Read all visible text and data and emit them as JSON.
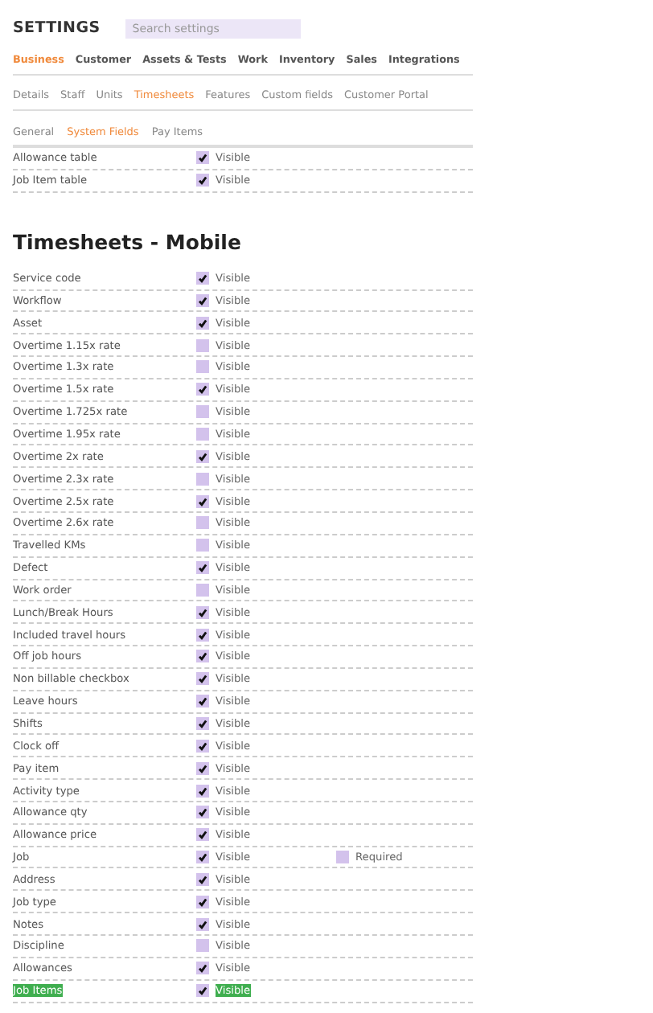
{
  "header": {
    "title": "SETTINGS",
    "search": {
      "placeholder": "Search settings"
    }
  },
  "main_tabs": [
    {
      "label": "Business",
      "selected": true
    },
    {
      "label": "Customer",
      "selected": false
    },
    {
      "label": "Assets & Tests",
      "selected": false
    },
    {
      "label": "Work",
      "selected": false
    },
    {
      "label": "Inventory",
      "selected": false
    },
    {
      "label": "Sales",
      "selected": false
    },
    {
      "label": "Integrations",
      "selected": false
    }
  ],
  "sub_tabs": [
    {
      "label": "Details",
      "selected": false
    },
    {
      "label": "Staff",
      "selected": false
    },
    {
      "label": "Units",
      "selected": false
    },
    {
      "label": "Timesheets",
      "selected": true
    },
    {
      "label": "Features",
      "selected": false
    },
    {
      "label": "Custom fields",
      "selected": false
    },
    {
      "label": "Customer Portal",
      "selected": false
    }
  ],
  "section_tabs": [
    {
      "label": "General",
      "selected": false
    },
    {
      "label": "System Fields",
      "selected": true
    },
    {
      "label": "Pay Items",
      "selected": false
    }
  ],
  "top_fields": [
    {
      "name": "Allowance table",
      "visible_label": "Visible",
      "visible": true,
      "highlighted": false
    },
    {
      "name": "Job Item table",
      "visible_label": "Visible",
      "visible": true,
      "highlighted": false
    }
  ],
  "mobile_section": {
    "heading": "Timesheets - Mobile",
    "fields": [
      {
        "name": "Service code",
        "visible_label": "Visible",
        "visible": true,
        "highlighted": false
      },
      {
        "name": "Workflow",
        "visible_label": "Visible",
        "visible": true,
        "highlighted": false
      },
      {
        "name": "Asset",
        "visible_label": "Visible",
        "visible": true,
        "highlighted": false
      },
      {
        "name": "Overtime 1.15x rate",
        "visible_label": "Visible",
        "visible": false,
        "highlighted": false
      },
      {
        "name": "Overtime 1.3x rate",
        "visible_label": "Visible",
        "visible": false,
        "highlighted": false
      },
      {
        "name": "Overtime 1.5x rate",
        "visible_label": "Visible",
        "visible": true,
        "highlighted": false
      },
      {
        "name": "Overtime 1.725x rate",
        "visible_label": "Visible",
        "visible": false,
        "highlighted": false
      },
      {
        "name": "Overtime 1.95x rate",
        "visible_label": "Visible",
        "visible": false,
        "highlighted": false
      },
      {
        "name": "Overtime 2x rate",
        "visible_label": "Visible",
        "visible": true,
        "highlighted": false
      },
      {
        "name": "Overtime 2.3x rate",
        "visible_label": "Visible",
        "visible": false,
        "highlighted": false
      },
      {
        "name": "Overtime 2.5x rate",
        "visible_label": "Visible",
        "visible": true,
        "highlighted": false
      },
      {
        "name": "Overtime 2.6x rate",
        "visible_label": "Visible",
        "visible": false,
        "highlighted": false
      },
      {
        "name": "Travelled KMs",
        "visible_label": "Visible",
        "visible": false,
        "highlighted": false
      },
      {
        "name": "Defect",
        "visible_label": "Visible",
        "visible": true,
        "highlighted": false
      },
      {
        "name": "Work order",
        "visible_label": "Visible",
        "visible": false,
        "highlighted": false
      },
      {
        "name": "Lunch/Break Hours",
        "visible_label": "Visible",
        "visible": true,
        "highlighted": false
      },
      {
        "name": "Included travel hours",
        "visible_label": "Visible",
        "visible": true,
        "highlighted": false
      },
      {
        "name": "Off job hours",
        "visible_label": "Visible",
        "visible": true,
        "highlighted": false
      },
      {
        "name": "Non billable checkbox",
        "visible_label": "Visible",
        "visible": true,
        "highlighted": false
      },
      {
        "name": "Leave hours",
        "visible_label": "Visible",
        "visible": true,
        "highlighted": false
      },
      {
        "name": "Shifts",
        "visible_label": "Visible",
        "visible": true,
        "highlighted": false
      },
      {
        "name": "Clock off",
        "visible_label": "Visible",
        "visible": true,
        "highlighted": false
      },
      {
        "name": "Pay item",
        "visible_label": "Visible",
        "visible": true,
        "highlighted": false
      },
      {
        "name": "Activity type",
        "visible_label": "Visible",
        "visible": true,
        "highlighted": false
      },
      {
        "name": "Allowance qty",
        "visible_label": "Visible",
        "visible": true,
        "highlighted": false
      },
      {
        "name": "Allowance price",
        "visible_label": "Visible",
        "visible": true,
        "highlighted": false
      },
      {
        "name": "Job",
        "visible_label": "Visible",
        "visible": true,
        "highlighted": false,
        "required_label": "Required",
        "required": false
      },
      {
        "name": "Address",
        "visible_label": "Visible",
        "visible": true,
        "highlighted": false
      },
      {
        "name": "Job type",
        "visible_label": "Visible",
        "visible": true,
        "highlighted": false
      },
      {
        "name": "Notes",
        "visible_label": "Visible",
        "visible": true,
        "highlighted": false
      },
      {
        "name": "Discipline",
        "visible_label": "Visible",
        "visible": false,
        "highlighted": false
      },
      {
        "name": "Allowances",
        "visible_label": "Visible",
        "visible": true,
        "highlighted": false
      },
      {
        "name": "Job Items",
        "visible_label": "Visible",
        "visible": true,
        "highlighted": true
      }
    ]
  }
}
